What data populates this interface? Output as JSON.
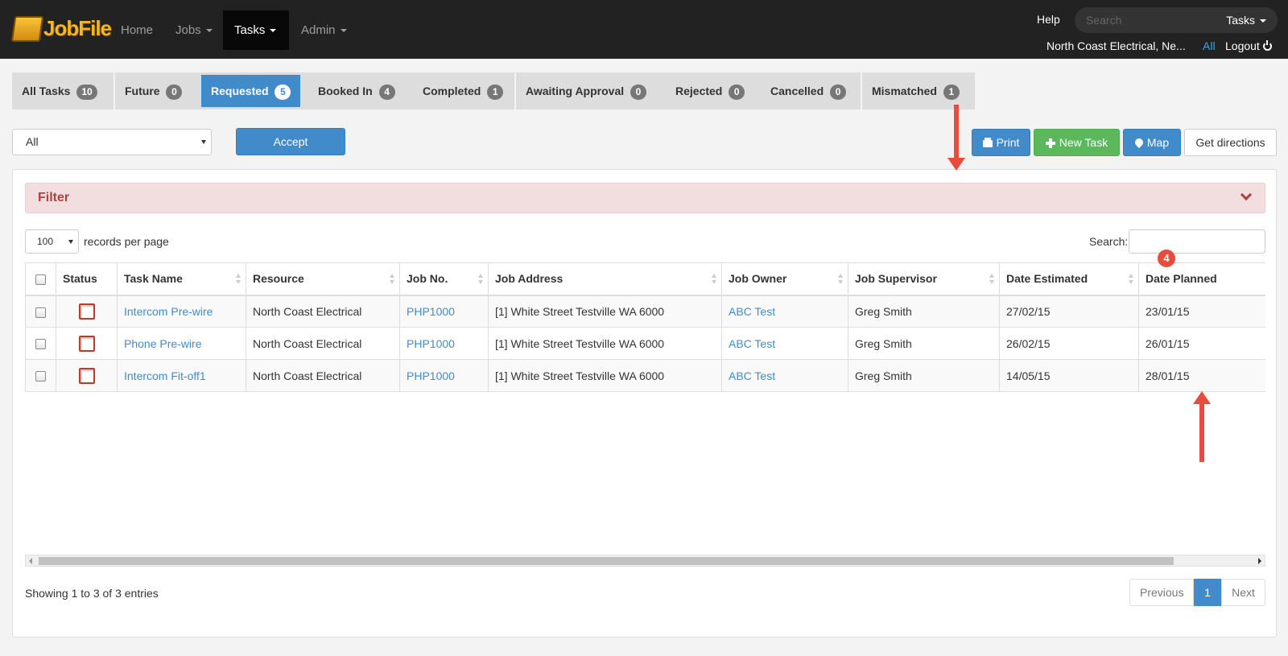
{
  "nav": {
    "logo_text": "JobFile",
    "items": [
      {
        "label": "Home"
      },
      {
        "label": "Jobs"
      },
      {
        "label": "Tasks"
      },
      {
        "label": "Admin"
      }
    ],
    "help": "Help",
    "search_placeholder": "Search",
    "search_scope": "Tasks",
    "company": "North Coast Electrical, Ne...",
    "all": "All",
    "logout": "Logout"
  },
  "tabs": [
    {
      "label": "All Tasks",
      "count": "10"
    },
    {
      "label": "Future",
      "count": "0"
    },
    {
      "label": "Requested",
      "count": "5"
    },
    {
      "label": "Booked In",
      "count": "4"
    },
    {
      "label": "Completed",
      "count": "1"
    },
    {
      "label": "Awaiting Approval",
      "count": "0"
    },
    {
      "label": "Rejected",
      "count": "0"
    },
    {
      "label": "Cancelled",
      "count": "0"
    },
    {
      "label": "Mismatched",
      "count": "1"
    }
  ],
  "toolbar": {
    "select_value": "All",
    "accept": "Accept",
    "print": "Print",
    "new_task": "New Task",
    "map": "Map",
    "directions": "Get directions"
  },
  "filter": {
    "label": "Filter"
  },
  "list": {
    "per_page_value": "100",
    "per_page_label": "records per page",
    "search_label": "Search:"
  },
  "table": {
    "columns": [
      "Status",
      "Task Name",
      "Resource",
      "Job No.",
      "Job Address",
      "Job Owner",
      "Job Supervisor",
      "Date Estimated",
      "Date Planned"
    ],
    "rows": [
      {
        "task": "Intercom Pre-wire",
        "resource": "North Coast Electrical",
        "job_no": "PHP1000",
        "address": "[1] White Street Testville WA 6000",
        "owner": "ABC Test",
        "supervisor": "Greg Smith",
        "estimated": "27/02/15",
        "planned": "23/01/15"
      },
      {
        "task": "Phone Pre-wire",
        "resource": "North Coast Electrical",
        "job_no": "PHP1000",
        "address": "[1] White Street Testville WA 6000",
        "owner": "ABC Test",
        "supervisor": "Greg Smith",
        "estimated": "26/02/15",
        "planned": "26/01/15"
      },
      {
        "task": "Intercom Fit-off1",
        "resource": "North Coast Electrical",
        "job_no": "PHP1000",
        "address": "[1] White Street Testville WA 6000",
        "owner": "ABC Test",
        "supervisor": "Greg Smith",
        "estimated": "14/05/15",
        "planned": "28/01/15"
      }
    ]
  },
  "footer": {
    "showing": "Showing 1 to 3 of 3 entries",
    "previous": "Previous",
    "page": "1",
    "next": "Next"
  },
  "annotation": {
    "number": "4"
  }
}
